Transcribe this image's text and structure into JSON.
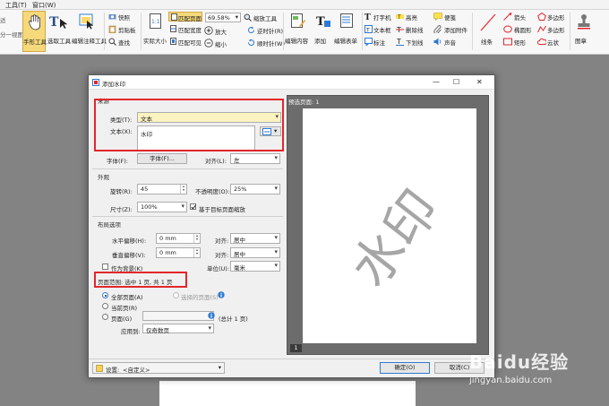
{
  "menu": {
    "tools": "工具(T)",
    "window": "窗口(W)"
  },
  "ribbon": {
    "view_btn": "适\n分一视图",
    "hand_tool": "手形工具",
    "select_tool": "选取工具",
    "annot_tool": "编辑注释工具",
    "snapshot": "快照",
    "clipboard": "剪贴板",
    "find": "查找",
    "actual_size": "实际大小",
    "fit_page": "匹配页面",
    "fit_width": "匹配宽度",
    "fit_visible": "匹配可见",
    "zoom_value": "69.58%",
    "zoom_tools": "缩放工具",
    "zoom_in": "放大",
    "zoom_out": "缩小",
    "rotate_ccw": "逆时针(R)",
    "rotate_cw": "顺时针(W)",
    "edit_content": "编辑内容",
    "add": "添加",
    "edit_form": "编辑表单",
    "typewriter": "打字机",
    "textbox": "文本框",
    "note": "标注",
    "highlight": "高亮",
    "strikeout": "删除线",
    "underline": "下划线",
    "sticky": "便笺",
    "attach": "添加附件",
    "sound": "声音",
    "line": "线条",
    "arrow": "箭头",
    "ellipse": "椭圆形",
    "rect": "矩形",
    "polygon": "多边形",
    "polyline": "多边形",
    "cloud": "云状",
    "stamp": "图章"
  },
  "dialog": {
    "title": "添加水印",
    "close": "✕",
    "maximize": "☐",
    "minimize": "—",
    "source_section": "来源",
    "type_label": "类型(T):",
    "type_value": "文本",
    "text_label": "文本(X):",
    "text_value": "水印",
    "font_label": "字体(F):",
    "font_btn": "字体(F)...",
    "align_label": "对齐(L):",
    "align_value": "左",
    "appearance_section": "外观",
    "rotation_label": "旋转(R):",
    "rotation_value": "45",
    "opacity_label": "不透明度(O):",
    "opacity_value": "25%",
    "size_label": "尺寸(Z):",
    "size_value": "100%",
    "scale_check": "基于目标页面缩放",
    "layout_section": "布局选项",
    "h_offset_label": "水平偏移(H):",
    "h_offset_value": "0 mm",
    "v_offset_label": "垂直偏移(V):",
    "v_offset_value": "0 mm",
    "h_align_label": "对齐:",
    "h_align_value": "居中",
    "v_align_label": "对齐:",
    "v_align_value": "居中",
    "background_check": "作为背景(K)",
    "unit_label": "单位(U):",
    "unit_value": "毫米",
    "range_section": "页面范围: 选中 1 页, 共 1 页",
    "all_pages": "全部页面(A)",
    "selected_pages": "选择的页面(S)",
    "current_page": "当前页(R)",
    "pages": "页面(G)",
    "pages_total": "(总计 1 页)",
    "apply_to_label": "应用到:",
    "apply_to_value": "仅奇数页",
    "preview_title": "预选页面: 1",
    "preview_watermark": "水印",
    "page_badge": "1",
    "settings_label": "设置:",
    "settings_value": "<自定义>",
    "ok_btn": "确定(O)",
    "cancel_btn": "取消(C)"
  },
  "watermark_site": {
    "brand": "Baidu经验",
    "url": "jingyan.baidu.com"
  },
  "colors": {
    "highlight_red": "#e3262c",
    "accent_blue": "#2f7ad1"
  }
}
